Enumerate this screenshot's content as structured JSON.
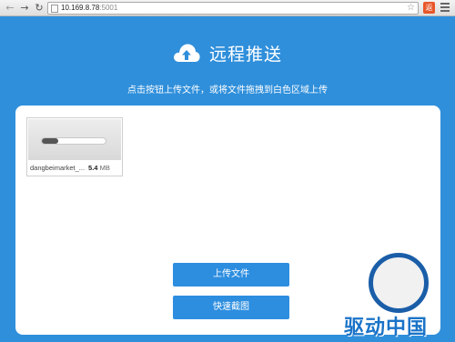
{
  "browser": {
    "url_host": "10.169.8.78",
    "url_port": ":5001",
    "back_icon": "arrow-left-icon",
    "forward_icon": "arrow-right-icon",
    "reload_icon": "reload-icon",
    "star_icon": "star-icon",
    "extension_icon": "extension-icon",
    "extension_label": "返",
    "menu_icon": "menu-icon"
  },
  "header": {
    "icon": "cloud-upload-icon",
    "title": "远程推送",
    "subtitle": "点击按钮上传文件，或将文件拖拽到白色区域上传"
  },
  "upload": {
    "files": [
      {
        "name": "dangbeimarket_...",
        "size": "5.4",
        "unit": "MB",
        "progress": 0.25
      }
    ],
    "upload_button": "上传文件",
    "screenshot_button": "快速截图"
  },
  "watermark": {
    "text": "驱动中国"
  },
  "colors": {
    "background": "#2f8fdb",
    "button": "#2d8ee0",
    "watermark": "#1a73c8"
  }
}
